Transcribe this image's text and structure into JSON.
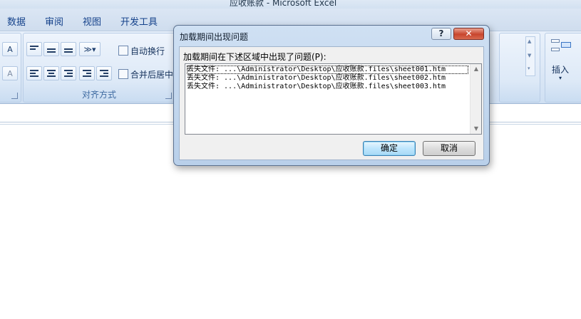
{
  "window": {
    "title": "应收账款 - Microsoft Excel"
  },
  "ribbon": {
    "tabs": [
      "数据",
      "审阅",
      "视图",
      "开发工具"
    ],
    "alignment_group": {
      "label": "对齐方式",
      "wrap_text": "自动换行",
      "merge_center": "合并后居中"
    },
    "font_glyphs": {
      "grow": "A",
      "shrink": "A"
    },
    "insert_label": "插入"
  },
  "dialog": {
    "title": "加载期间出现问题",
    "help_glyph": "?",
    "close_glyph": "✕",
    "prompt": "加载期间在下述区域中出现了问题(P):",
    "items": [
      "丢失文件: ...\\Administrator\\Desktop\\应收账款.files\\sheet001.htm",
      "丢失文件: ...\\Administrator\\Desktop\\应收账款.files\\sheet002.htm",
      "丢失文件: ...\\Administrator\\Desktop\\应收账款.files\\sheet003.htm"
    ],
    "ok_label": "确定",
    "cancel_label": "取消"
  },
  "colors": {
    "accent": "#15428b",
    "ribbon": "#dce8f6",
    "close": "#c8452d"
  }
}
